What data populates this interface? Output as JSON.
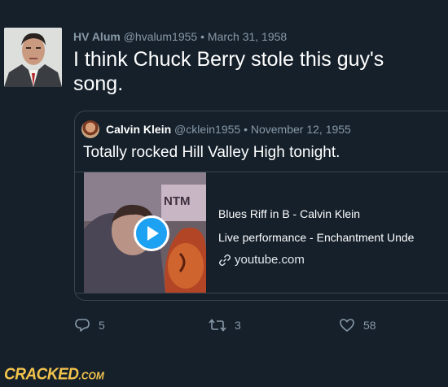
{
  "tweet": {
    "author_name": "HV Alum",
    "handle": "@hvalum1955",
    "separator": "•",
    "date": "March 31, 1958",
    "text": "I think Chuck Berry stole this guy's song."
  },
  "quoted_tweet": {
    "author_name": "Calvin Klein",
    "handle": "@cklein1955",
    "separator": "•",
    "date": "November 12, 1955",
    "text": "Totally rocked Hill Valley High tonight.",
    "media": {
      "title": "Blues Riff in B - Calvin Klein",
      "description": "Live performance - Enchantment Unde",
      "domain": "youtube.com",
      "thumbnail_text": "NTM"
    }
  },
  "actions": {
    "replies": "5",
    "retweets": "3",
    "likes": "58"
  },
  "watermark": {
    "brand": "CRACKED",
    "suffix": ".COM"
  },
  "colors": {
    "background": "#15202b",
    "border": "#38444d",
    "muted": "#8899a6",
    "accent": "#1da1f2",
    "logo": "#f2c34c"
  },
  "icons": {
    "reply": "reply-icon",
    "retweet": "retweet-icon",
    "like": "heart-icon",
    "link": "link-icon",
    "play": "play-icon"
  }
}
